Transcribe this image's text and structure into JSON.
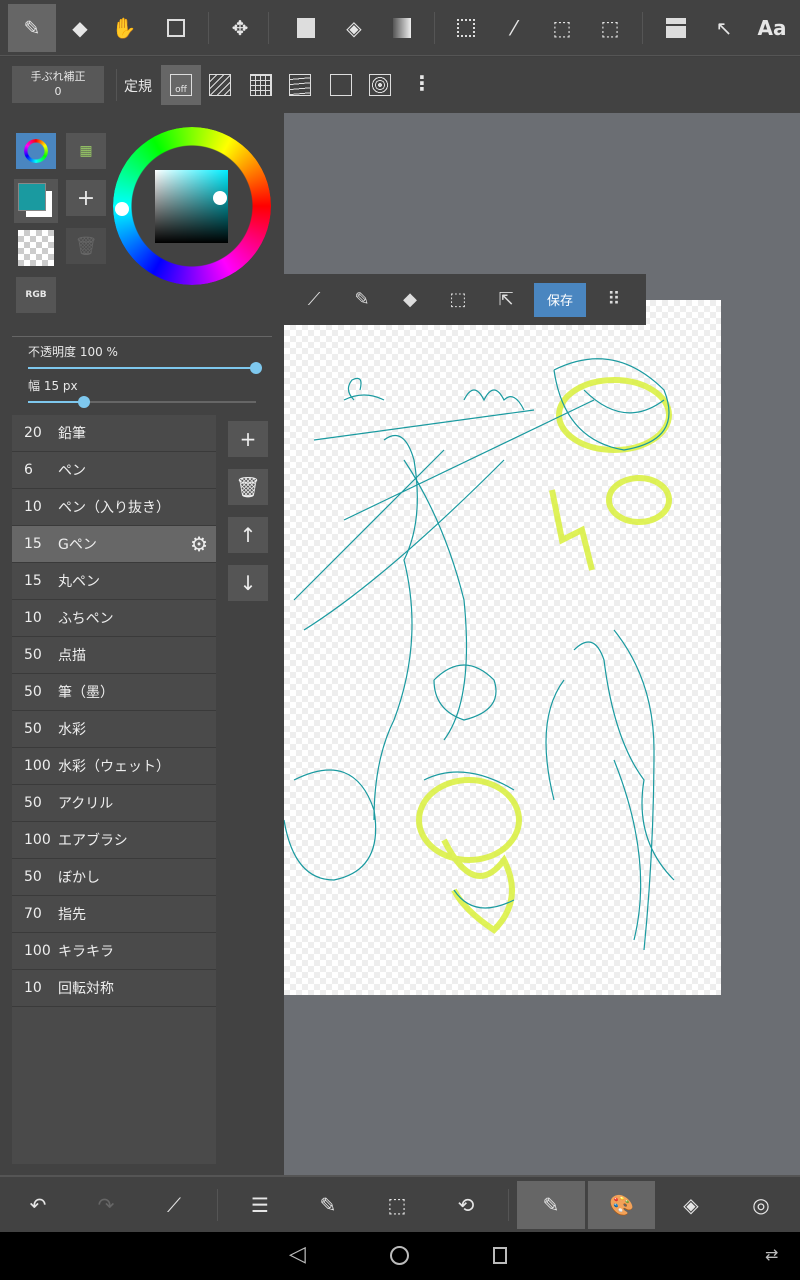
{
  "toolbar": {
    "tools": [
      "pen-icon",
      "eraser-icon",
      "hand-icon",
      "rectangle-icon",
      "move-icon",
      "fill-rect-icon",
      "bucket-icon",
      "gradient-icon",
      "select-rect-icon",
      "magic-wand-icon",
      "select-pen-icon",
      "select-eraser-icon",
      "frame-icon",
      "cursor-icon"
    ],
    "text_tool": "Aa"
  },
  "subbar": {
    "stabilizer_label": "手ぶれ補正",
    "stabilizer_value": "0",
    "ruler_label": "定規",
    "ruler_off": "off"
  },
  "color": {
    "current": "#1a9aa0",
    "rgb_label": "RGB"
  },
  "opacity": {
    "label": "不透明度 100 %",
    "value": 100
  },
  "width": {
    "label": "幅 15 px",
    "value": 15,
    "fraction": 0.24
  },
  "brushes": [
    {
      "size": "20",
      "name": "鉛筆"
    },
    {
      "size": "6",
      "name": "ペン"
    },
    {
      "size": "10",
      "name": "ペン（入り抜き）"
    },
    {
      "size": "15",
      "name": "Gペン",
      "selected": true
    },
    {
      "size": "15",
      "name": "丸ペン"
    },
    {
      "size": "10",
      "name": "ふちペン"
    },
    {
      "size": "50",
      "name": "点描"
    },
    {
      "size": "50",
      "name": "筆（墨）"
    },
    {
      "size": "50",
      "name": "水彩"
    },
    {
      "size": "100",
      "name": "水彩（ウェット）"
    },
    {
      "size": "50",
      "name": "アクリル"
    },
    {
      "size": "100",
      "name": "エアブラシ"
    },
    {
      "size": "50",
      "name": "ぼかし"
    },
    {
      "size": "70",
      "name": "指先"
    },
    {
      "size": "100",
      "name": "キラキラ"
    },
    {
      "size": "10",
      "name": "回転対称"
    }
  ],
  "float": {
    "save": "保存"
  }
}
